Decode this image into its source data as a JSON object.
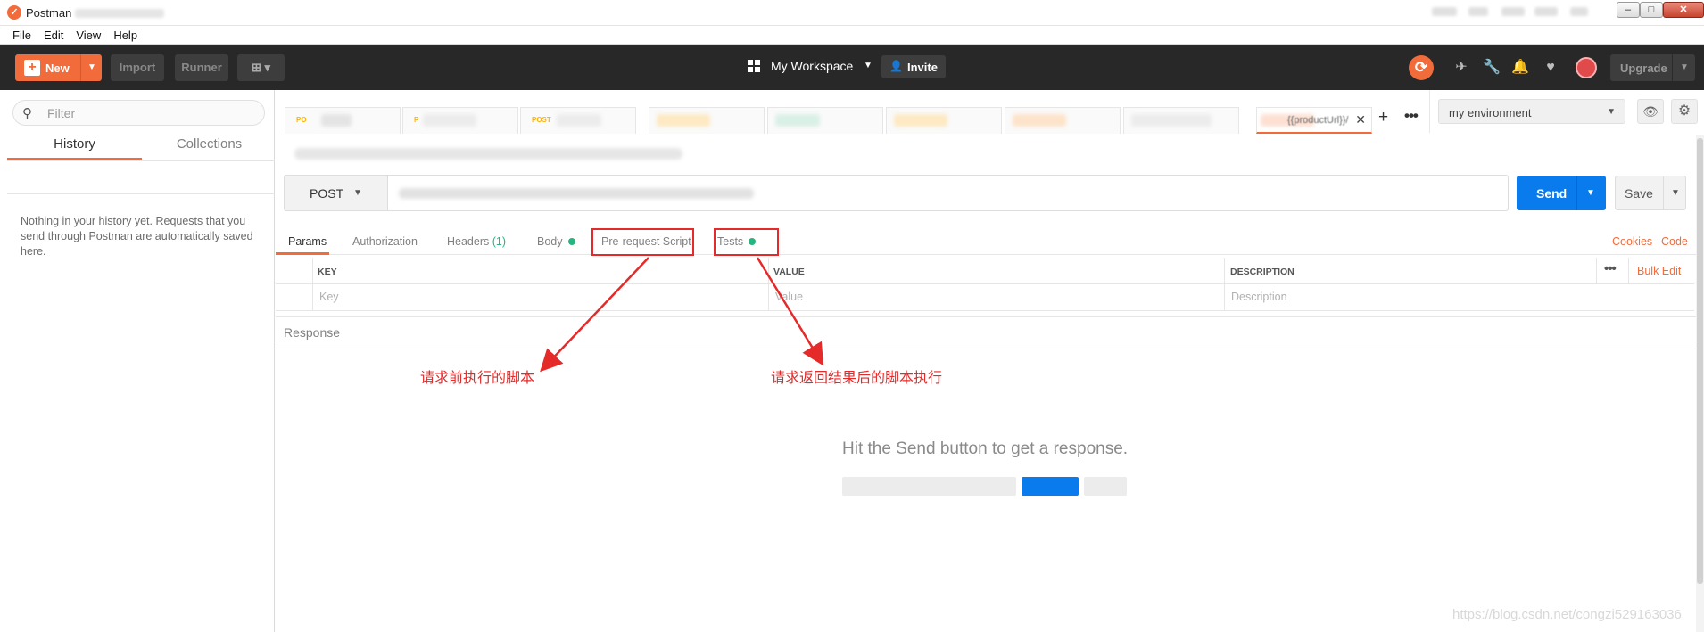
{
  "window": {
    "app_icon": "postman-logo",
    "title": "Postman",
    "minimize": "–",
    "maximize": "□",
    "close": "✕"
  },
  "menu": [
    "File",
    "Edit",
    "View",
    "Help"
  ],
  "header": {
    "new_label": "New",
    "import_label": "Import",
    "runner_label": "Runner",
    "workspace_label": "My Workspace",
    "invite_label": "Invite",
    "upgrade_label": "Upgrade"
  },
  "sidebar": {
    "search_placeholder": "Filter",
    "tabs": [
      "History",
      "Collections"
    ],
    "active_tab": "History",
    "empty_message": "Nothing in your history yet. Requests that you send through Postman are automatically saved here."
  },
  "request_tabs": [
    {
      "method": "PO"
    },
    {
      "method": "P"
    },
    {
      "method": "POST"
    },
    {},
    {},
    {},
    {},
    {},
    {
      "label": "{{productUrl}}/",
      "active": true
    }
  ],
  "environment": {
    "selected": "my environment"
  },
  "request": {
    "method": "POST",
    "send_label": "Send",
    "save_label": "Save",
    "tabs": [
      {
        "label": "Params",
        "active": true
      },
      {
        "label": "Authorization"
      },
      {
        "label": "Headers",
        "count": "(1)"
      },
      {
        "label": "Body",
        "dot": true
      },
      {
        "label": "Pre-request Script",
        "highlighted": true
      },
      {
        "label": "Tests",
        "dot": true,
        "highlighted": true
      }
    ],
    "links": {
      "cookies": "Cookies",
      "code": "Code"
    }
  },
  "params_table": {
    "headers": [
      "KEY",
      "VALUE",
      "DESCRIPTION"
    ],
    "placeholders": {
      "key": "Key",
      "value": "Value",
      "description": "Description"
    },
    "bulk_edit": "Bulk Edit"
  },
  "response": {
    "title": "Response",
    "empty_message": "Hit the Send button to get a response."
  },
  "annotations": {
    "pre_request": "请求前执行的脚本",
    "tests": "请求返回结果后的脚本执行",
    "color": "#e52a2a"
  },
  "colors": {
    "brand": "#f26b3a",
    "send": "#097bed",
    "status_dot": "#26b47f",
    "header_bg": "#282828"
  },
  "watermark": "https://blog.csdn.net/congzi529163036"
}
